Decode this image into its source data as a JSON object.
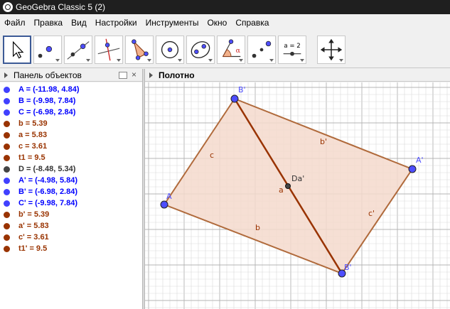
{
  "window": {
    "title": "GeoGebra Classic 5 (2)"
  },
  "menu": [
    "Файл",
    "Правка",
    "Вид",
    "Настройки",
    "Инструменты",
    "Окно",
    "Справка"
  ],
  "toolbar": {
    "tools": [
      {
        "name": "move-tool",
        "icon": "arrow-pointer-icon",
        "active": true
      },
      {
        "name": "point-tool",
        "icon": "point-icon"
      },
      {
        "name": "line-tool",
        "icon": "line-icon"
      },
      {
        "name": "perpendicular-tool",
        "icon": "perpendicular-icon"
      },
      {
        "name": "polygon-tool",
        "icon": "polygon-icon"
      },
      {
        "name": "circle-tool",
        "icon": "circle-icon"
      },
      {
        "name": "ellipse-tool",
        "icon": "ellipse-icon"
      },
      {
        "name": "angle-tool",
        "icon": "angle-icon",
        "label": "α"
      },
      {
        "name": "reflect-tool",
        "icon": "reflect-icon"
      },
      {
        "name": "slider-tool",
        "icon": "slider-icon",
        "label": "a = 2"
      },
      {
        "name": "move-view-tool",
        "icon": "move-arrows-icon"
      }
    ]
  },
  "algebra_panel": {
    "title": "Панель объектов",
    "items": [
      {
        "text": "A = (-11.98, 4.84)",
        "color": "blue"
      },
      {
        "text": "B = (-9.98, 7.84)",
        "color": "blue"
      },
      {
        "text": "C = (-6.98, 2.84)",
        "color": "blue"
      },
      {
        "text": "b = 5.39",
        "color": "brown"
      },
      {
        "text": "a = 5.83",
        "color": "brown"
      },
      {
        "text": "c = 3.61",
        "color": "brown"
      },
      {
        "text": "t1 = 9.5",
        "color": "brown"
      },
      {
        "text": "D = (-8.48, 5.34)",
        "color": "dark"
      },
      {
        "text": "A' = (-4.98, 5.84)",
        "color": "blue"
      },
      {
        "text": "B' = (-6.98, 2.84)",
        "color": "blue"
      },
      {
        "text": "C' = (-9.98, 7.84)",
        "color": "blue"
      },
      {
        "text": "b' = 5.39",
        "color": "brown"
      },
      {
        "text": "a' = 5.83",
        "color": "brown"
      },
      {
        "text": "c' = 3.61",
        "color": "brown"
      },
      {
        "text": "t1' = 9.5",
        "color": "brown"
      }
    ]
  },
  "graphics": {
    "title": "Полотно",
    "colors": {
      "point": "#4d4dff",
      "segment": "#b06a3b",
      "fill": "#f5d9cc",
      "diagonal": "#993300",
      "grid": "#d9d9d9",
      "gridMajor": "#b4b4b4",
      "label_point": "#4d4dff",
      "label_seg": "#993300"
    },
    "point_labels": {
      "A": "A",
      "B_prime": "B'",
      "A_prime": "A'",
      "B_and_C_prime": "B'",
      "D": "Da'"
    },
    "segment_labels": {
      "c": "c",
      "b_prime": "b'",
      "a": "a",
      "c_prime": "c'",
      "b": "b"
    }
  }
}
